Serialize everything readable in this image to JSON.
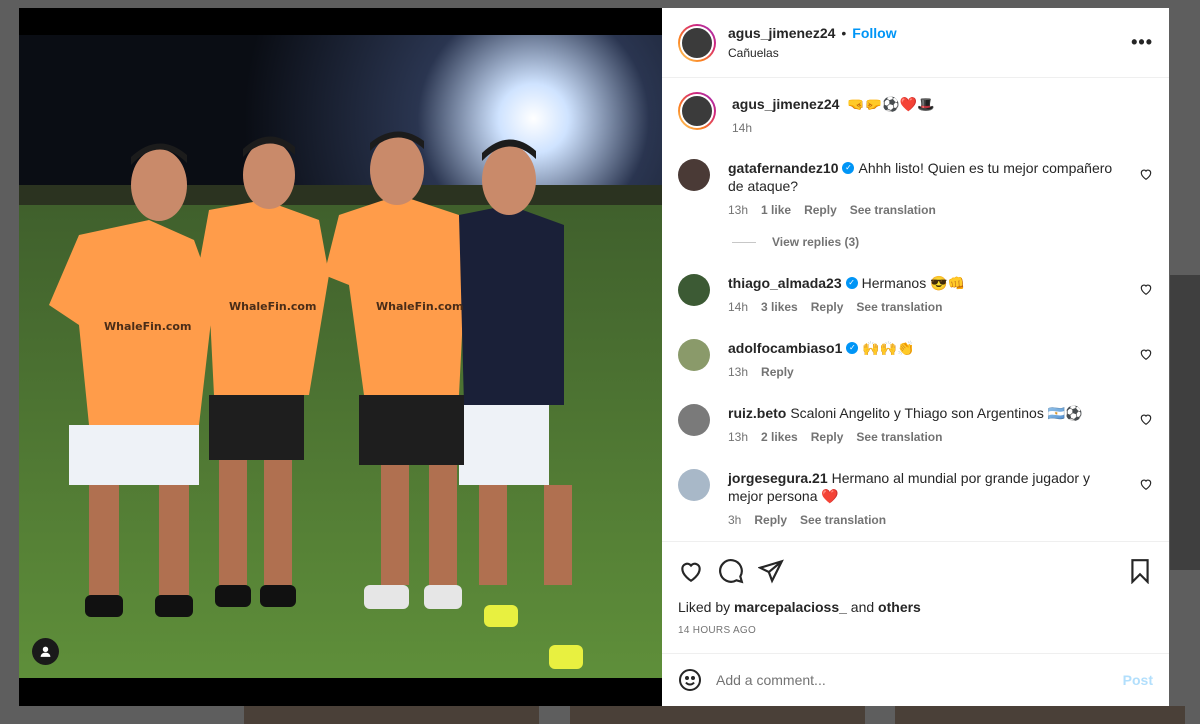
{
  "post": {
    "username": "agus_jimenez24",
    "follow_label": "Follow",
    "separator": "•",
    "location": "Cañuelas",
    "more_label": "•••",
    "caption_emojis": "🤜🤛⚽❤️🎩",
    "caption_time": "14h",
    "printed_in_photo": "WhaleFin.com"
  },
  "comments": [
    {
      "user": "gatafernandez10",
      "verified": true,
      "text": "Ahhh listo! Quien es tu mejor compañero de ataque?",
      "time": "13h",
      "likes": "1 like",
      "reply": "Reply",
      "translate": "See translation",
      "view_replies": "View replies (3)"
    },
    {
      "user": "thiago_almada23",
      "verified": true,
      "text": "Hermanos 😎👊",
      "time": "14h",
      "likes": "3 likes",
      "reply": "Reply",
      "translate": "See translation"
    },
    {
      "user": "adolfocambiaso1",
      "verified": true,
      "text": "🙌🙌👏",
      "time": "13h",
      "reply": "Reply"
    },
    {
      "user": "ruiz.beto",
      "verified": false,
      "text": "Scaloni Angelito y Thiago son Argentinos 🇦🇷⚽",
      "time": "13h",
      "likes": "2 likes",
      "reply": "Reply",
      "translate": "See translation"
    },
    {
      "user": "jorgesegura.21",
      "verified": false,
      "text": "Hermano al mundial por grande jugador y mejor persona ❤️",
      "time": "3h",
      "reply": "Reply",
      "translate": "See translation"
    }
  ],
  "footer": {
    "liked_by_prefix": "Liked by",
    "liked_by_user": "marcepalacioss_",
    "liked_by_and": "and",
    "liked_by_others": "others",
    "timestamp": "14 HOURS AGO",
    "add_comment_placeholder": "Add a comment...",
    "post_label": "Post"
  },
  "icons": {
    "like": "heart-icon",
    "comment": "comment-icon",
    "share": "share-icon",
    "save": "bookmark-icon",
    "emoji": "emoji-icon",
    "tag": "user-tag-icon"
  },
  "colors": {
    "accent": "#0095f6",
    "jersey": "#ff9c4a"
  }
}
